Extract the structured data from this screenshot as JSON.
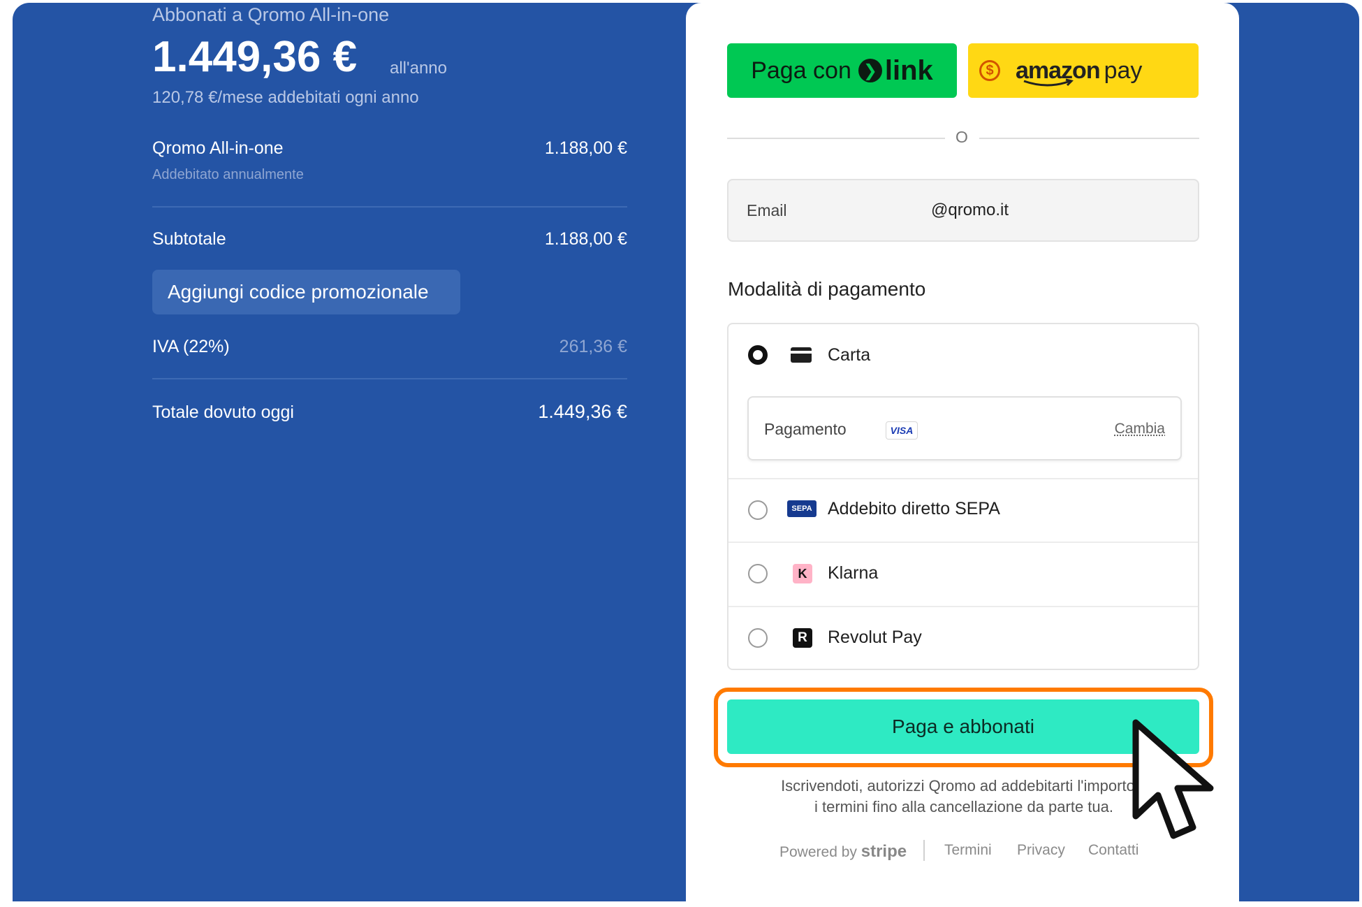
{
  "summary": {
    "subscribe_title": "Abbonati a Qromo All-in-one",
    "price": "1.449,36 €",
    "price_period": "all'anno",
    "monthly_note": "120,78 €/mese addebitati ogni anno",
    "product_name": "Qromo All-in-one",
    "product_price": "1.188,00 €",
    "product_billing": "Addebitato annualmente",
    "subtotal_label": "Subtotale",
    "subtotal_value": "1.188,00 €",
    "promo_label": "Aggiungi codice promozionale",
    "vat_label": "IVA (22%)",
    "vat_value": "261,36 €",
    "total_label": "Totale dovuto oggi",
    "total_value": "1.449,36 €"
  },
  "checkout": {
    "link_button_prefix": "Paga con",
    "link_brand": "link",
    "amazon_brand": "amazon",
    "amazon_pay": "pay",
    "or_text": "O",
    "email_label": "Email",
    "email_value": "@qromo.it",
    "payment_section_title": "Modalità di pagamento",
    "methods": [
      {
        "label": "Carta",
        "selected": true
      },
      {
        "label": "Addebito diretto SEPA",
        "selected": false
      },
      {
        "label": "Klarna",
        "selected": false
      },
      {
        "label": "Revolut Pay",
        "selected": false
      }
    ],
    "card_detail_label": "Pagamento",
    "card_brand": "VISA",
    "change_link": "Cambia",
    "sepa_logo_text": "SEPA",
    "klarna_logo_text": "K",
    "revolut_logo_text": "R",
    "pay_button": "Paga e abbonati",
    "legal_line1": "Iscrivendoti, autorizzi Qromo ad addebitarti l'importo s",
    "legal_line2": "i termini fino alla cancellazione da parte tua.",
    "powered_by": "Powered by",
    "stripe": "stripe",
    "footer_links": [
      "Termini",
      "Privacy",
      "Contatti"
    ]
  },
  "colors": {
    "panel_blue": "#2454a5",
    "link_green": "#00c853",
    "amazon_yellow": "#ffd814",
    "pay_teal": "#2eeac3",
    "highlight_orange": "#ff7a00"
  }
}
